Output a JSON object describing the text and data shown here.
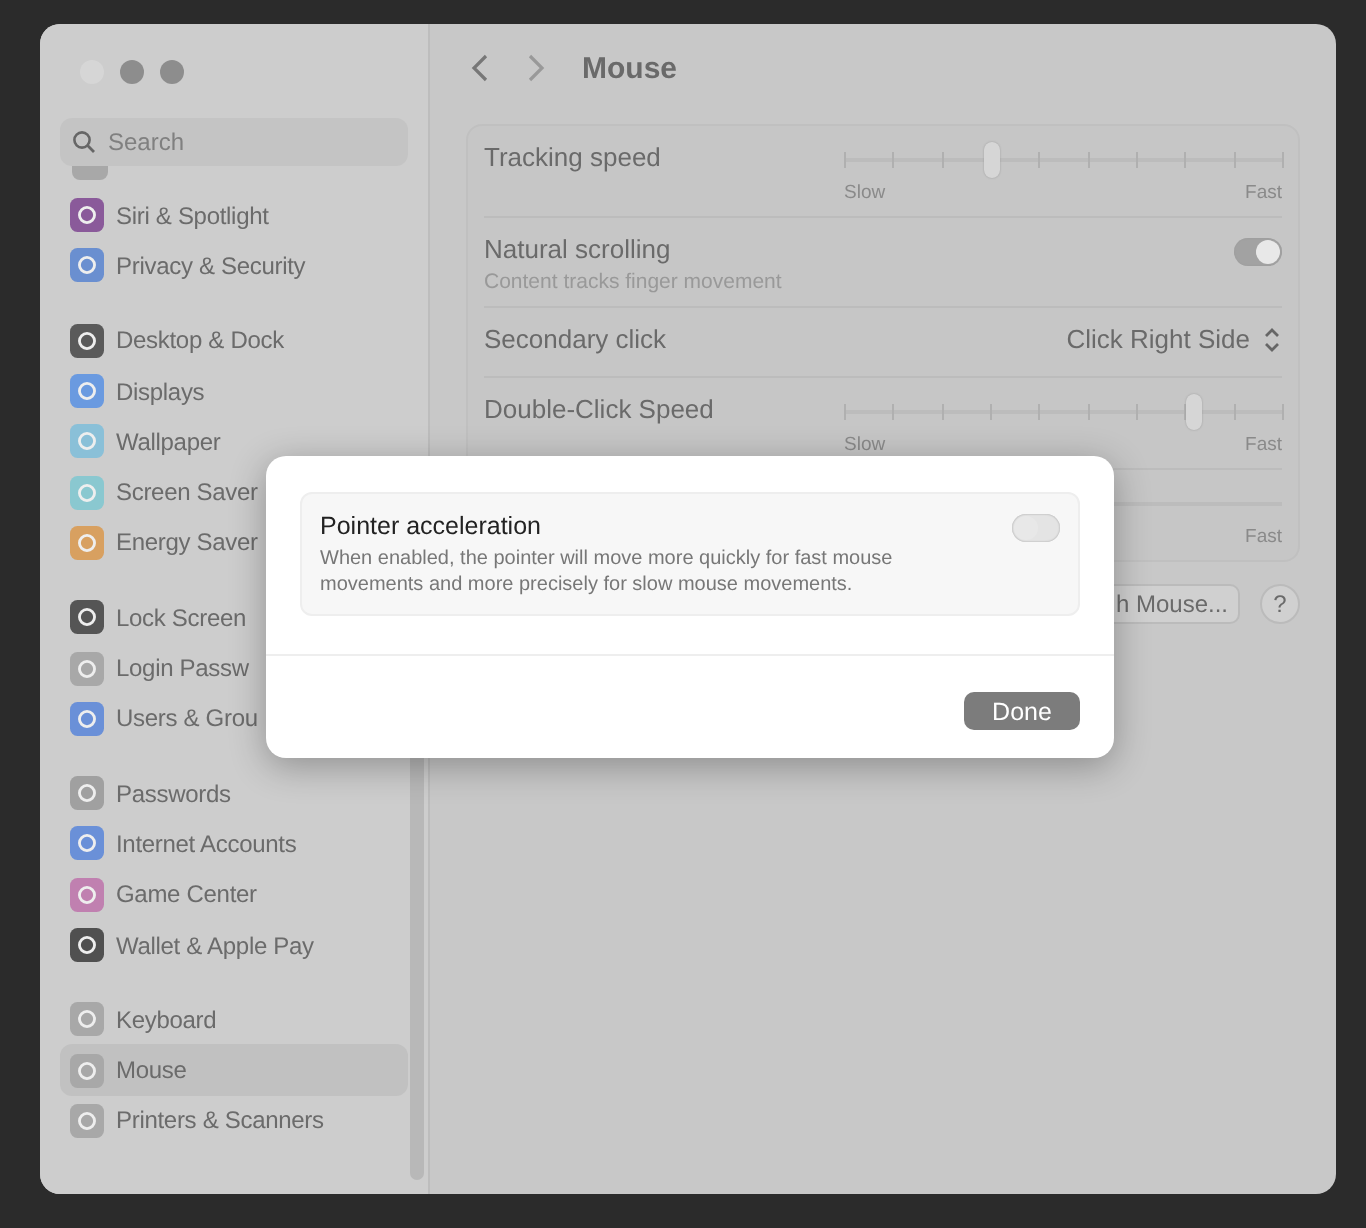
{
  "search": {
    "placeholder": "Search"
  },
  "sidebar": {
    "groups": [
      {
        "items": [
          {
            "label": "Siri & Spotlight",
            "color": "#8a5a9a",
            "selected": false
          },
          {
            "label": "Privacy & Security",
            "color": "#6a8fd0",
            "selected": false
          }
        ]
      },
      {
        "items": [
          {
            "label": "Desktop & Dock",
            "color": "#5a5a5a",
            "selected": false
          },
          {
            "label": "Displays",
            "color": "#6a9ae0",
            "selected": false
          },
          {
            "label": "Wallpaper",
            "color": "#8ac0d8",
            "selected": false
          },
          {
            "label": "Screen Saver",
            "color": "#8ac8d0",
            "selected": false
          },
          {
            "label": "Energy Saver",
            "color": "#d8a060",
            "selected": false
          }
        ]
      },
      {
        "items": [
          {
            "label": "Lock Screen",
            "color": "#555555",
            "selected": false
          },
          {
            "label": "Login Passw",
            "color": "#a8a8a8",
            "selected": false
          },
          {
            "label": "Users & Grou",
            "color": "#6a90d8",
            "selected": false
          }
        ]
      },
      {
        "items": [
          {
            "label": "Passwords",
            "color": "#a0a0a0",
            "selected": false
          },
          {
            "label": "Internet Accounts",
            "color": "#6a90d8",
            "selected": false
          },
          {
            "label": "Game Center",
            "color": "#c080b0",
            "selected": false
          },
          {
            "label": "Wallet & Apple Pay",
            "color": "#505050",
            "selected": false
          }
        ]
      },
      {
        "items": [
          {
            "label": "Keyboard",
            "color": "#a8a8a8",
            "selected": false
          },
          {
            "label": "Mouse",
            "color": "#a8a8a8",
            "selected": true
          },
          {
            "label": "Printers & Scanners",
            "color": "#a8a8a8",
            "selected": false
          }
        ]
      }
    ]
  },
  "title": "Mouse",
  "rows": [
    {
      "kind": "slider",
      "label": "Tracking speed",
      "level": 0.34,
      "min_label": "Slow",
      "max_label": "Fast"
    },
    {
      "kind": "toggle",
      "label": "Natural scrolling",
      "subtitle": "Content tracks finger movement",
      "on": true
    },
    {
      "kind": "popup",
      "label": "Secondary click",
      "value": "Click Right Side"
    },
    {
      "kind": "slider",
      "label": "Double-Click Speed",
      "level": 0.8,
      "min_label": "Slow",
      "max_label": "Fast"
    },
    {
      "kind": "hidden-slider",
      "max_label": "Fast"
    }
  ],
  "buttons": [
    {
      "label": "h Mouse..."
    },
    {
      "label": "?"
    }
  ],
  "dialog": {
    "title": "Pointer acceleration",
    "description": "When enabled, the pointer will move more quickly for fast mouse movements and more precisely for slow mouse movements.",
    "on": false,
    "button": "Done"
  }
}
